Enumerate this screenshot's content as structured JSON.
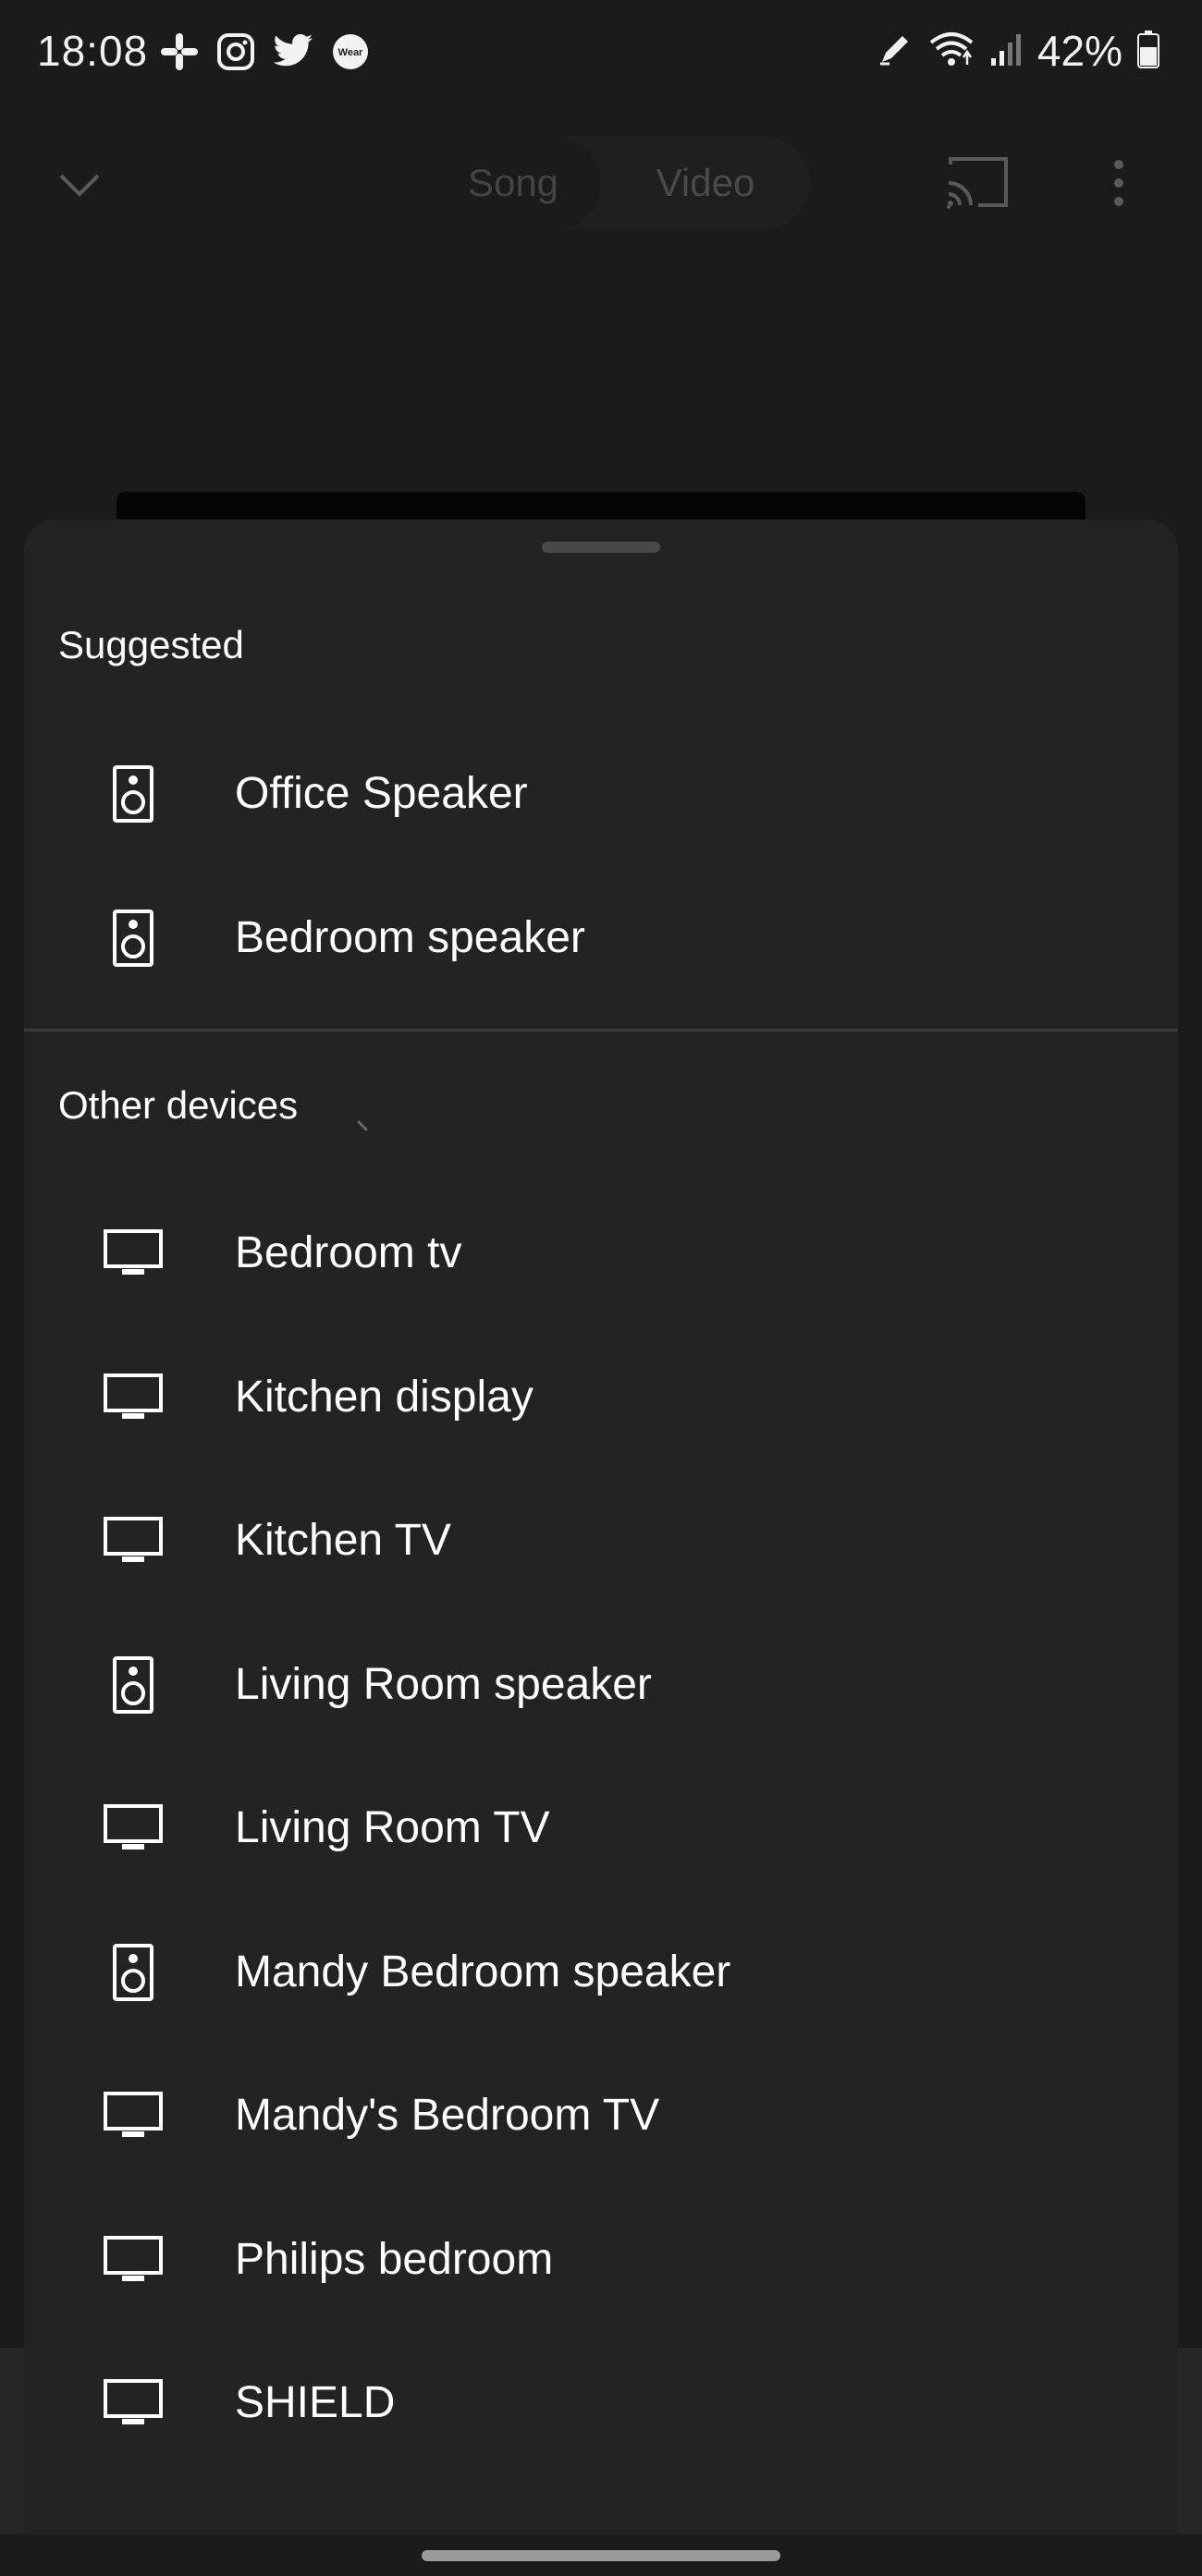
{
  "status_bar": {
    "time": "18:08",
    "battery": "42%",
    "left_icons": [
      "slack-icon",
      "instagram-icon",
      "twitter-icon",
      "wear-icon"
    ],
    "wear_label": "Wear",
    "right_icons": [
      "pen-icon",
      "wifi-icon",
      "signal-icon",
      "battery-icon"
    ]
  },
  "app_bar": {
    "tabs": [
      "Song",
      "Video"
    ],
    "selected_tab": "Video"
  },
  "sheet": {
    "suggested_title": "Suggested",
    "suggested": [
      {
        "label": "Office Speaker",
        "icon": "speaker-icon"
      },
      {
        "label": "Bedroom speaker",
        "icon": "speaker-icon"
      }
    ],
    "other_title": "Other devices",
    "other": [
      {
        "label": "Bedroom tv",
        "icon": "tv-icon"
      },
      {
        "label": "Kitchen display",
        "icon": "tv-icon"
      },
      {
        "label": "Kitchen TV",
        "icon": "tv-icon"
      },
      {
        "label": "Living Room speaker",
        "icon": "speaker-icon"
      },
      {
        "label": "Living Room TV",
        "icon": "tv-icon"
      },
      {
        "label": "Mandy Bedroom speaker",
        "icon": "speaker-icon"
      },
      {
        "label": "Mandy's Bedroom TV",
        "icon": "tv-icon"
      },
      {
        "label": "Philips bedroom",
        "icon": "tv-icon"
      },
      {
        "label": "SHIELD",
        "icon": "tv-icon"
      }
    ]
  },
  "colors": {
    "background": "#1b1b1b",
    "sheet": "#232323",
    "text": "#ffffff",
    "divider": "#3a3a3a"
  }
}
